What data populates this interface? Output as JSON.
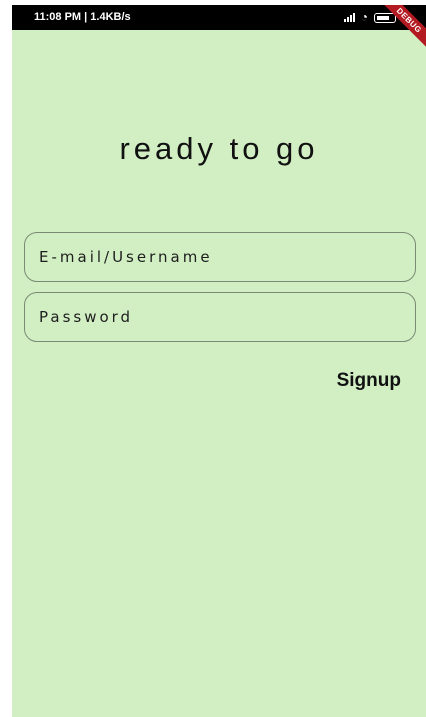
{
  "status_bar": {
    "left_text": "11:08 PM | 1.4KB/s",
    "icons": [
      "alarm-icon",
      "signal-icon",
      "wifi-icon",
      "battery-icon"
    ],
    "debug_label": "DEBUG"
  },
  "title": "ready to go",
  "form": {
    "email_placeholder": "E-mail/Username",
    "password_placeholder": "Password"
  },
  "signup_label": "Signup",
  "colors": {
    "background": "#d1efc3",
    "status_bar": "#000000",
    "debug_banner": "#b31a21"
  }
}
